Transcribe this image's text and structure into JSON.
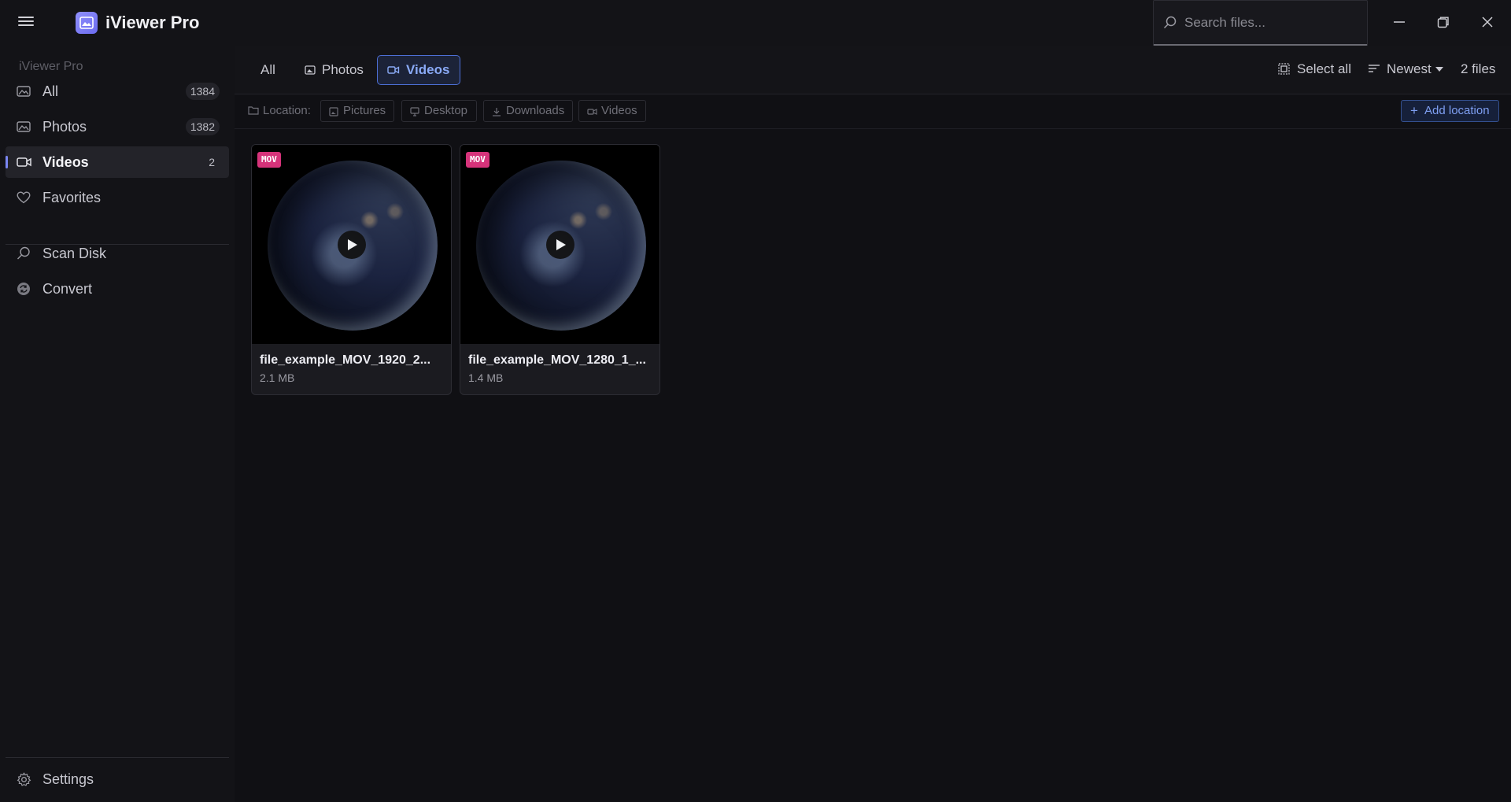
{
  "app": {
    "title": "iViewer Pro"
  },
  "search": {
    "placeholder": "Search files..."
  },
  "sidebar": {
    "header": "iViewer Pro",
    "items": [
      {
        "label": "All",
        "count": "1384",
        "icon": "image-icon"
      },
      {
        "label": "Photos",
        "count": "1382",
        "icon": "image-icon"
      },
      {
        "label": "Videos",
        "count": "2",
        "icon": "video-icon",
        "active": true
      },
      {
        "label": "Favorites",
        "icon": "heart-icon"
      },
      {
        "label": "Scan Disk",
        "icon": "search-icon"
      },
      {
        "label": "Convert",
        "icon": "convert-icon"
      }
    ],
    "settings": "Settings"
  },
  "toolbar": {
    "tabs": [
      {
        "label": "All"
      },
      {
        "label": "Photos"
      },
      {
        "label": "Videos",
        "active": true
      }
    ],
    "select_all": "Select all",
    "sort": "Newest",
    "file_count": "2 files"
  },
  "location": {
    "label": "Location:",
    "chips": [
      "Pictures",
      "Desktop",
      "Downloads",
      "Videos"
    ],
    "add": "Add location"
  },
  "files": [
    {
      "name": "file_example_MOV_1920_2...",
      "size": "2.1 MB",
      "badge": "MOV"
    },
    {
      "name": "file_example_MOV_1280_1_...",
      "size": "1.4 MB",
      "badge": "MOV"
    }
  ],
  "colors": {
    "accent": "#7a86f2",
    "badge": "#d6337a",
    "active_tab_border": "#4d6fd6"
  }
}
